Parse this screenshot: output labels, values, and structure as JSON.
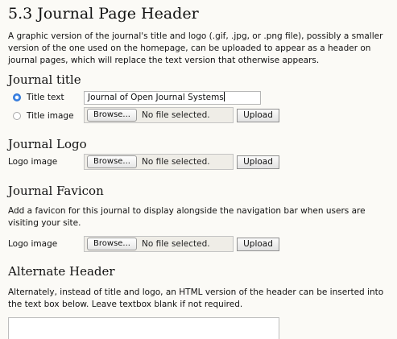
{
  "section": {
    "heading": "5.3 Journal Page Header",
    "description": "A graphic version of the journal's title and logo (.gif, .jpg, or .png file), possibly a smaller version of the one used on the homepage, can be uploaded to appear as a header on journal pages, which will replace the text version that otherwise appears."
  },
  "journal_title": {
    "heading": "Journal title",
    "title_text_label": "Title text",
    "title_text_value": "Journal of Open Journal Systems",
    "title_image_label": "Title image",
    "selected_option": "Title text",
    "browse_label": "Browse...",
    "file_status": "No file selected.",
    "upload_label": "Upload"
  },
  "journal_logo": {
    "heading": "Journal Logo",
    "field_label": "Logo image",
    "browse_label": "Browse...",
    "file_status": "No file selected.",
    "upload_label": "Upload"
  },
  "journal_favicon": {
    "heading": "Journal Favicon",
    "description": "Add a favicon for this journal to display alongside the navigation bar when users are visiting your site.",
    "field_label": "Logo image",
    "browse_label": "Browse...",
    "file_status": "No file selected.",
    "upload_label": "Upload"
  },
  "alternate_header": {
    "heading": "Alternate Header",
    "description": "Alternately, instead of title and logo, an HTML version of the header can be inserted into the text box below. Leave textbox blank if not required.",
    "textarea_value": ""
  },
  "colors": {
    "page_background": "#fbfaf6",
    "radio_selected": "#3d84e6",
    "file_field_background": "#efede7"
  }
}
